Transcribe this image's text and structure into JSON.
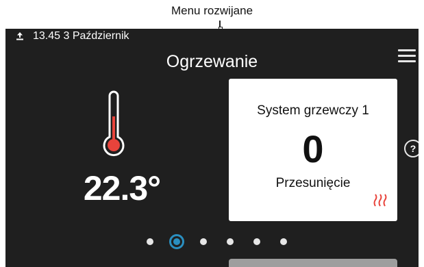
{
  "callout": {
    "text": "Menu rozwijane"
  },
  "status_bar": {
    "datetime": "13.45 3 Październik",
    "icon": "upload-icon"
  },
  "page": {
    "title": "Ogrzewanie"
  },
  "indoor": {
    "temperature": "22.3°",
    "icon": "thermometer-icon"
  },
  "card": {
    "system_name": "System grzewczy 1",
    "value": "0",
    "label": "Przesunięcie",
    "icon": "heat-waves-icon",
    "icon_color": "#e8433b"
  },
  "help": {
    "label": "?"
  },
  "pagination": {
    "count": 6,
    "active_index": 1,
    "accent": "#2a8fc0"
  }
}
